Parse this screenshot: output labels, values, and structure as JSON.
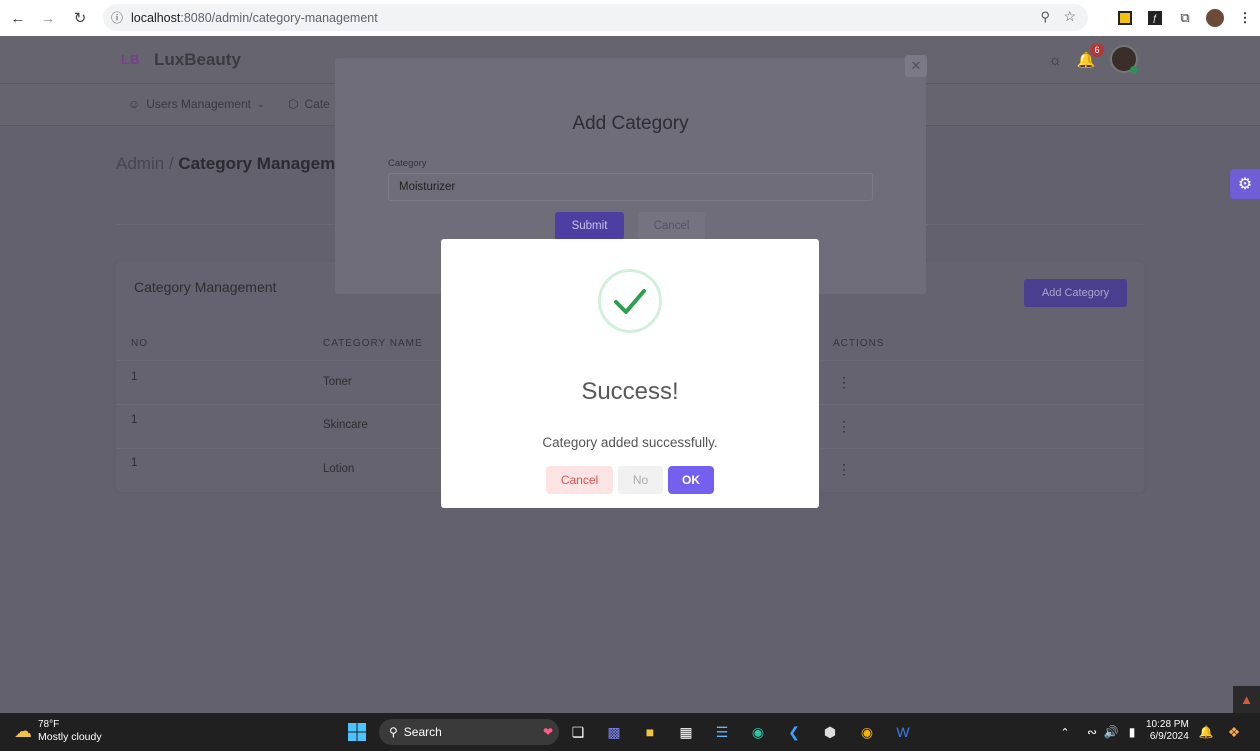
{
  "browser": {
    "url_host": "localhost",
    "url_path": ":8080/admin/category-management"
  },
  "app": {
    "logo_mark": "LB",
    "brand": "LuxBeauty",
    "notification_count": "6",
    "nav": [
      {
        "label": "Users Management"
      },
      {
        "label": "Cate"
      }
    ],
    "breadcrumb": {
      "root": "Admin /",
      "current": "Category Manageme"
    }
  },
  "card": {
    "title": "Category Management",
    "add_button": "Add Category",
    "columns": [
      "NO",
      "CATEGORY NAME",
      "ACTIONS"
    ],
    "rows": [
      {
        "no": "1",
        "name": "Toner"
      },
      {
        "no": "1",
        "name": "Skincare"
      },
      {
        "no": "1",
        "name": "Lotion"
      }
    ]
  },
  "add_modal": {
    "title": "Add Category",
    "label": "Category",
    "value": "Moisturizer",
    "submit": "Submit",
    "cancel": "Cancel"
  },
  "success_dialog": {
    "heading": "Success!",
    "message": "Category added successfully.",
    "cancel": "Cancel",
    "no": "No",
    "ok": "OK"
  },
  "taskbar": {
    "temp": "78°F",
    "condition": "Mostly cloudy",
    "search": "Search",
    "time": "10:28 PM",
    "date": "6/9/2024"
  },
  "colors": {
    "accent": "#7460ee",
    "success": "#2e9f4f"
  }
}
